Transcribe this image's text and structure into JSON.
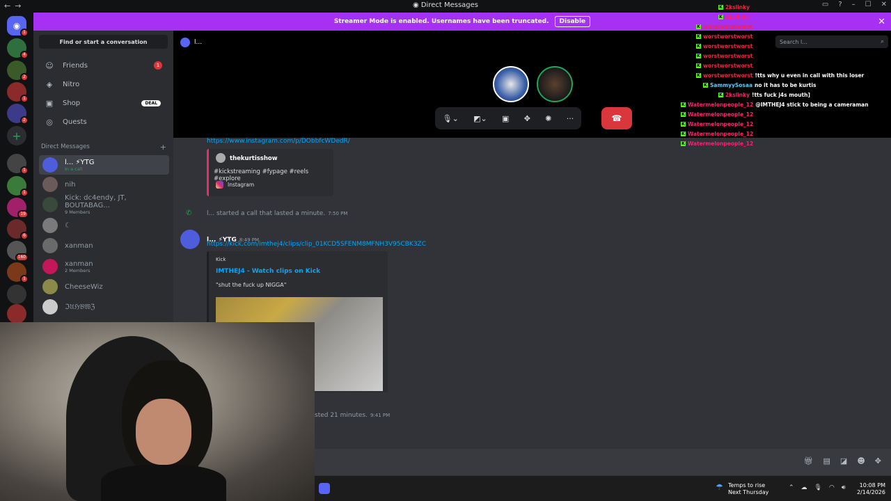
{
  "window": {
    "title": "Direct Messages",
    "minimize": "–",
    "maximize": "☐",
    "close": "✕"
  },
  "banner": {
    "text": "Streamer Mode is enabled. Usernames have been truncated.",
    "button": "Disable"
  },
  "servers": {
    "badges": [
      "1",
      "4",
      "2",
      "1",
      "2",
      "1",
      "1",
      "19",
      "6",
      "160",
      "1"
    ]
  },
  "sidebar": {
    "find": "Find or start a conversation",
    "nav": [
      {
        "label": "Friends",
        "badge": "1"
      },
      {
        "label": "Nitro"
      },
      {
        "label": "Shop",
        "tag": "DEAL"
      },
      {
        "label": "Quests"
      }
    ],
    "dm_header": "Direct Messages",
    "dms": [
      {
        "name": "l... ⚡YTG",
        "sub": "In a call"
      },
      {
        "name": "nih",
        "sub": ""
      },
      {
        "name": "Kick: dc4endy, JT, BOUTABAG...",
        "sub": "9 Members"
      },
      {
        "name": "☾",
        "sub": ""
      },
      {
        "name": "xanman",
        "sub": ""
      },
      {
        "name": "xanman",
        "sub": "2 Members"
      },
      {
        "name": "CheeseWiz",
        "sub": ""
      },
      {
        "name": "ℑ𝔘ℌ𝔅𝔚ℨ",
        "sub": ""
      }
    ]
  },
  "call": {
    "header": "l...",
    "search_placeholder": "Search l..."
  },
  "messages": {
    "insta_link": "https://www.instagram.com/p/DObbfcWDedR/",
    "insta_author": "thekurtisshow",
    "insta_desc": "#kickstreaming #fypage #reels #explore",
    "insta_provider": "Instagram",
    "call1_text": "l... started a call that lasted a minute.",
    "call1_time": "7:50 PM",
    "msg_author": "l... ⚡YTG",
    "msg_time": "8:49 PM",
    "kick_link": "https://kick.com/imthej4/clips/clip_01KCD5SFENM8MFNH3V95CBK3ZC",
    "kick_provider": "Kick",
    "kick_title": "IMTHEJ4 - Watch clips on Kick",
    "kick_desc": "\"shut the fuck up NIGGA\"",
    "call2_text": "sted 21 minutes.",
    "call2_time": "9:41 PM"
  },
  "chat_overlay": [
    {
      "user": "2kslinky",
      "msg": ""
    },
    {
      "user": "2kslinky",
      "msg": ""
    },
    {
      "user": "worstworstworst",
      "msg": ""
    },
    {
      "user": "worstworstworst",
      "msg": ""
    },
    {
      "user": "worstworstworst",
      "msg": ""
    },
    {
      "user": "worstworstworst",
      "msg": ""
    },
    {
      "user": "worstworstworst",
      "msg": ""
    },
    {
      "user": "worstworstworst",
      "msg": "!tts why u even in call with this loser"
    },
    {
      "user": "SammyySosaa",
      "msg": "no it has to be kurtis"
    },
    {
      "user": "2kslinky",
      "msg": "!tts fuck j4s mouth]"
    },
    {
      "user": "Watermelonpeople_12",
      "msg": "@IMTHEJ4 stick to being a cameraman"
    },
    {
      "user": "Watermelonpeople_12",
      "msg": ""
    },
    {
      "user": "Watermelonpeople_12",
      "msg": ""
    },
    {
      "user": "Watermelonpeople_12",
      "msg": ""
    },
    {
      "user": "Watermelonpeople_12",
      "msg": ""
    }
  ],
  "taskbar": {
    "weather_line1": "Temps to rise",
    "weather_line2": "Next Thursday",
    "time": "10:08 PM",
    "date": "2/14/2026"
  },
  "colors": {
    "accent": "#5865f2",
    "banner": "#a631f3",
    "link": "#00a8fc",
    "hangup": "#da373c",
    "kick_green": "#53fc18"
  }
}
